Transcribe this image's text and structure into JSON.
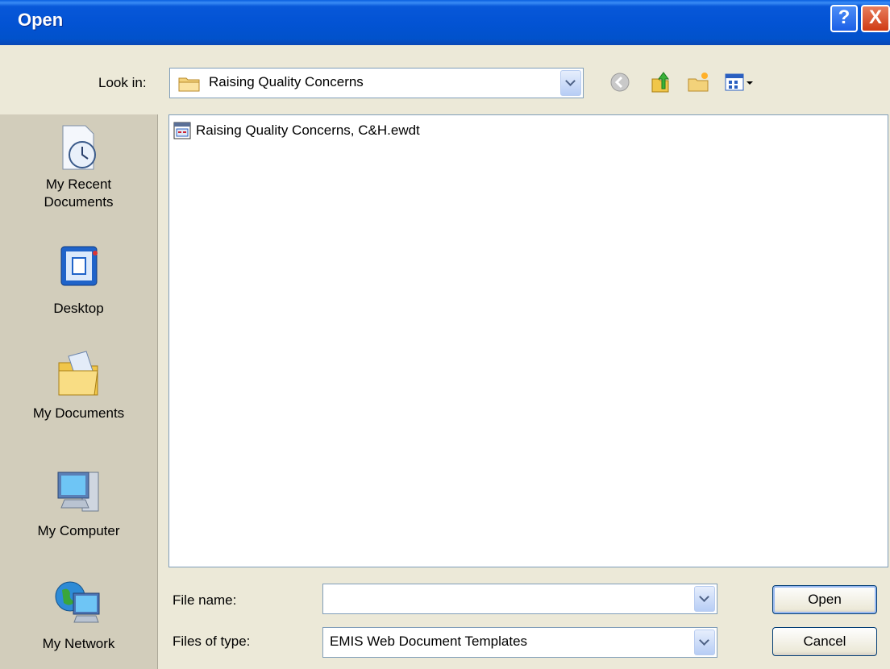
{
  "window": {
    "title": "Open"
  },
  "title_buttons": {
    "help": "?",
    "close": "X"
  },
  "look_in": {
    "label": "Look in:",
    "value": "Raising Quality Concerns"
  },
  "toolbar": {
    "back": "back-icon",
    "up": "up-one-level-icon",
    "new_folder": "new-folder-icon",
    "views": "views-menu-icon"
  },
  "places": {
    "items": [
      {
        "line1": "My Recent",
        "line2": "Documents",
        "icon": "recent-documents-icon"
      },
      {
        "line1": "Desktop",
        "line2": "",
        "icon": "desktop-icon"
      },
      {
        "line1": "My Documents",
        "line2": "",
        "icon": "my-documents-icon"
      },
      {
        "line1": "My Computer",
        "line2": "",
        "icon": "my-computer-icon"
      },
      {
        "line1": "My Network",
        "line2": "",
        "icon": "my-network-icon"
      }
    ]
  },
  "files": [
    {
      "name": "Raising Quality Concerns, C&H.ewdt",
      "icon": "template-file-icon"
    }
  ],
  "file_name": {
    "label": "File name:",
    "value": ""
  },
  "file_type": {
    "label": "Files of type:",
    "value": "EMIS Web Document Templates"
  },
  "buttons": {
    "open": "Open",
    "cancel": "Cancel"
  },
  "colors": {
    "titlebar": "#0353d4",
    "dialog_bg": "#ece9d8",
    "places_bg": "#d2cdbb",
    "border": "#7f9db9"
  }
}
